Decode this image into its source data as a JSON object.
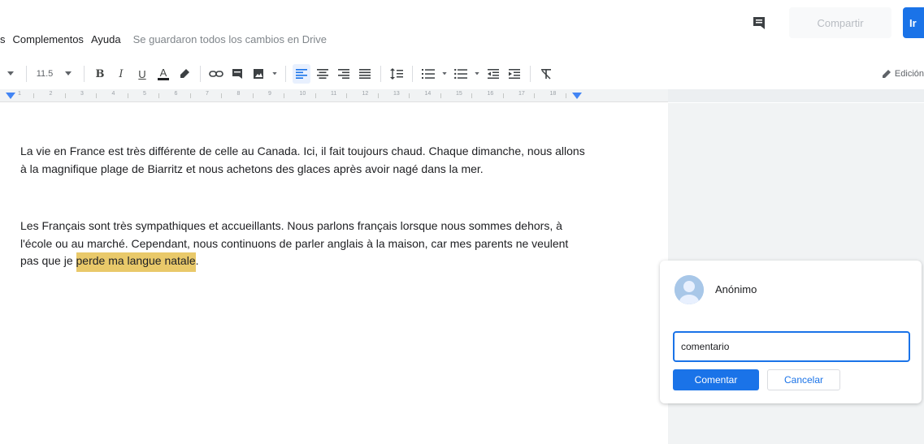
{
  "menu": {
    "cut_label": "s",
    "addons": "Complementos",
    "help": "Ayuda",
    "save_status": "Se guardaron todos los cambios en Drive"
  },
  "top": {
    "share_label": "Compartir",
    "blue_tab_label": "Ir"
  },
  "toolbar": {
    "font_size": "11.5",
    "bold": "B",
    "italic": "I",
    "underline": "U",
    "text_color": "A",
    "edit_mode": "Edición"
  },
  "ruler": {
    "numbers": [
      "1",
      "2",
      "3",
      "4",
      "5",
      "6",
      "7",
      "8",
      "9",
      "10",
      "11",
      "12",
      "13",
      "14",
      "15",
      "16",
      "17",
      "18"
    ]
  },
  "doc": {
    "para1": "La vie en France est très différente de celle au Canada. Ici, il fait toujours chaud. Chaque dimanche, nous allons à la magnifique plage de Biarritz et nous achetons des glaces après avoir nagé dans la mer.",
    "para2_before": "Les Français sont très sympathiques et accueillants. Nous parlons français lorsque nous sommes dehors, à l'école ou au marché. Cependant, nous continuons de parler anglais à la maison, car mes parents ne veulent pas que je ",
    "para2_highlight": "perde ma langue natale",
    "para2_after": "."
  },
  "comment": {
    "author": "Anónimo",
    "input_value": "comentario",
    "submit_label": "Comentar",
    "cancel_label": "Cancelar"
  },
  "colors": {
    "accent": "#1a73e8",
    "highlight": "#e9c96a"
  }
}
